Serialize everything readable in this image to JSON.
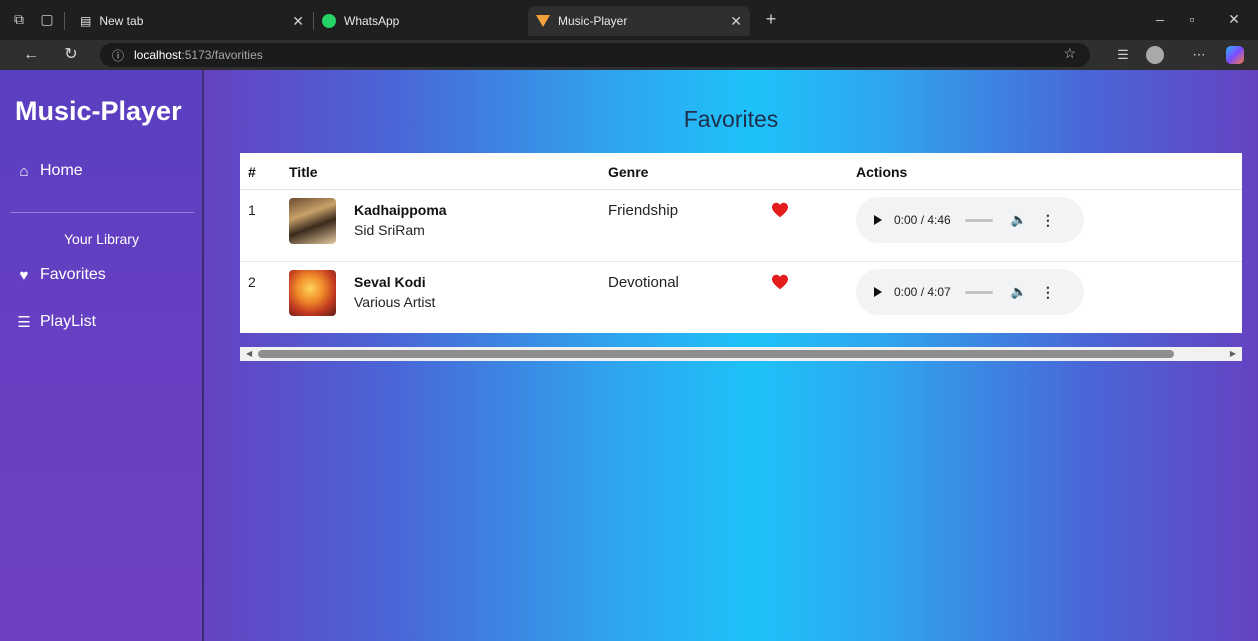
{
  "browser": {
    "tabs": [
      {
        "label": "New tab",
        "active": false
      },
      {
        "label": "WhatsApp",
        "active": false
      },
      {
        "label": "Music-Player",
        "active": true
      }
    ],
    "new_tab_symbol": "+",
    "address": {
      "host": "localhost",
      "path": ":5173/favorities"
    }
  },
  "app": {
    "brand": "Music-Player",
    "nav": {
      "home": "Home",
      "library_label": "Your Library",
      "favorites": "Favorites",
      "playlist": "PlayList"
    },
    "page_title": "Favorites",
    "table": {
      "headers": {
        "num": "#",
        "title": "Title",
        "genre": "Genre",
        "actions": "Actions"
      },
      "rows": [
        {
          "num": "1",
          "title": "Kadhaippoma",
          "artist": "Sid SriRam",
          "genre": "Friendship",
          "time": "0:00 / 4:46",
          "liked": true
        },
        {
          "num": "2",
          "title": "Seval Kodi",
          "artist": "Various Artist",
          "genre": "Devotional",
          "time": "0:00 / 4:07",
          "liked": true
        }
      ]
    }
  },
  "colors": {
    "heart": "#e31b1b",
    "sidebar": "#5a3fc0",
    "accent_cyan": "#1ec2fb"
  }
}
